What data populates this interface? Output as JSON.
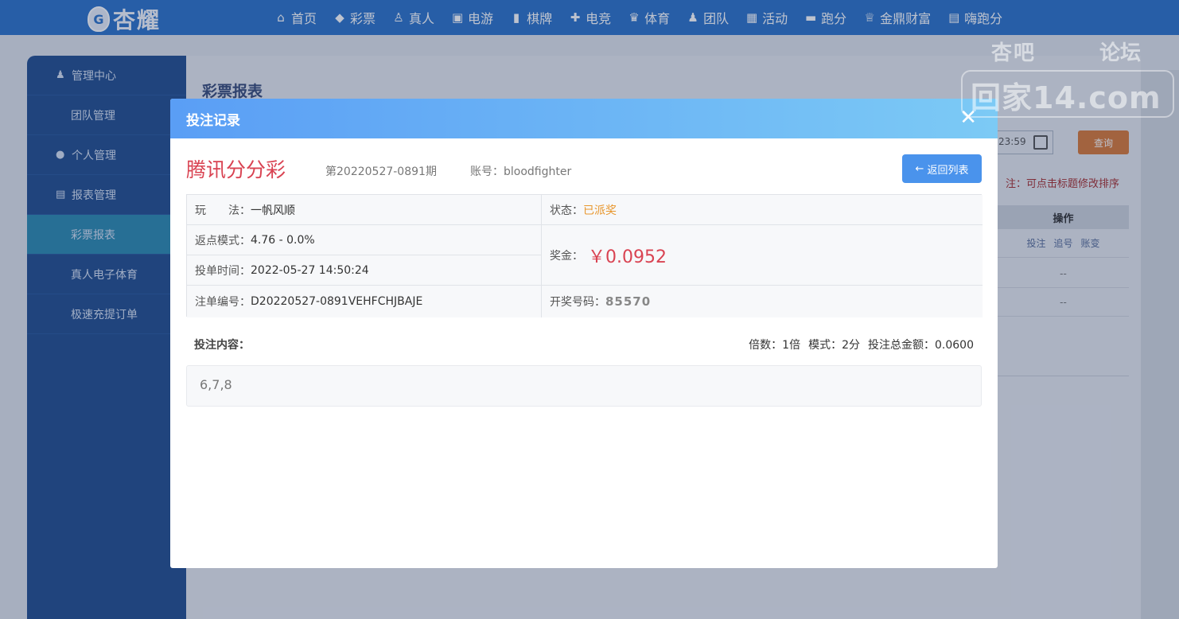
{
  "nav": {
    "logo_text": "杏耀",
    "items": [
      {
        "label": "首页",
        "icon": "home-icon"
      },
      {
        "label": "彩票",
        "icon": "ticket-icon"
      },
      {
        "label": "真人",
        "icon": "person-icon"
      },
      {
        "label": "电游",
        "icon": "slot-icon"
      },
      {
        "label": "棋牌",
        "icon": "cards-icon"
      },
      {
        "label": "电竞",
        "icon": "gamepad-icon"
      },
      {
        "label": "体育",
        "icon": "trophy-icon"
      },
      {
        "label": "团队",
        "icon": "team-icon"
      },
      {
        "label": "活动",
        "icon": "gift-icon"
      },
      {
        "label": "跑分",
        "icon": "car-icon"
      },
      {
        "label": "金鼎财富",
        "icon": "cup-icon"
      },
      {
        "label": "嗨跑分",
        "icon": "hi-icon"
      }
    ]
  },
  "sidebar": {
    "items": [
      {
        "label": "管理中心",
        "type": "group",
        "icon": "team-icon"
      },
      {
        "label": "团队管理",
        "type": "sub"
      },
      {
        "label": "个人管理",
        "type": "group",
        "icon": "user-icon"
      },
      {
        "label": "报表管理",
        "type": "group",
        "icon": "report-icon"
      },
      {
        "label": "彩票报表",
        "type": "sub",
        "active": true
      },
      {
        "label": "真人电子体育",
        "type": "sub"
      },
      {
        "label": "极速充提订单",
        "type": "sub"
      }
    ]
  },
  "main": {
    "title": "彩票报表",
    "date_fragment": "23:59",
    "query_label": "查询",
    "note": "注：可点击标题修改排序",
    "ops_header": "操作",
    "ops_links": [
      "投注",
      "追号",
      "账变"
    ],
    "empty_mark": "--"
  },
  "modal": {
    "title": "投注记录",
    "close_glyph": "✕",
    "lottery_name": "腾讯分分彩",
    "period": "第20220527-0891期",
    "account_label": "账号：",
    "account_value": "bloodfighter",
    "back_label": "返回列表",
    "play_label": "玩　　法：",
    "play_value": "一帆风顺",
    "status_label": "状态：",
    "status_value": "已派奖",
    "rebate_label": "返点模式：",
    "rebate_value": "4.76 - 0.0%",
    "time_label": "投单时间：",
    "time_value": "2022-05-27 14:50:24",
    "prize_label": "奖金：",
    "prize_value": "￥0.0952",
    "order_label": "注单编号：",
    "order_value": "D20220527-0891VEHFCHJBAJE",
    "draw_label": "开奖号码：",
    "draw_value": "85570",
    "content_label": "投注内容：",
    "multiplier": "倍数：1倍",
    "mode": "模式：2分",
    "total": "投注总金额：0.0600",
    "bet_content": "6,7,8"
  },
  "watermark": {
    "top_left": "杏吧",
    "top_right": "论坛",
    "url": "回家14.com"
  }
}
